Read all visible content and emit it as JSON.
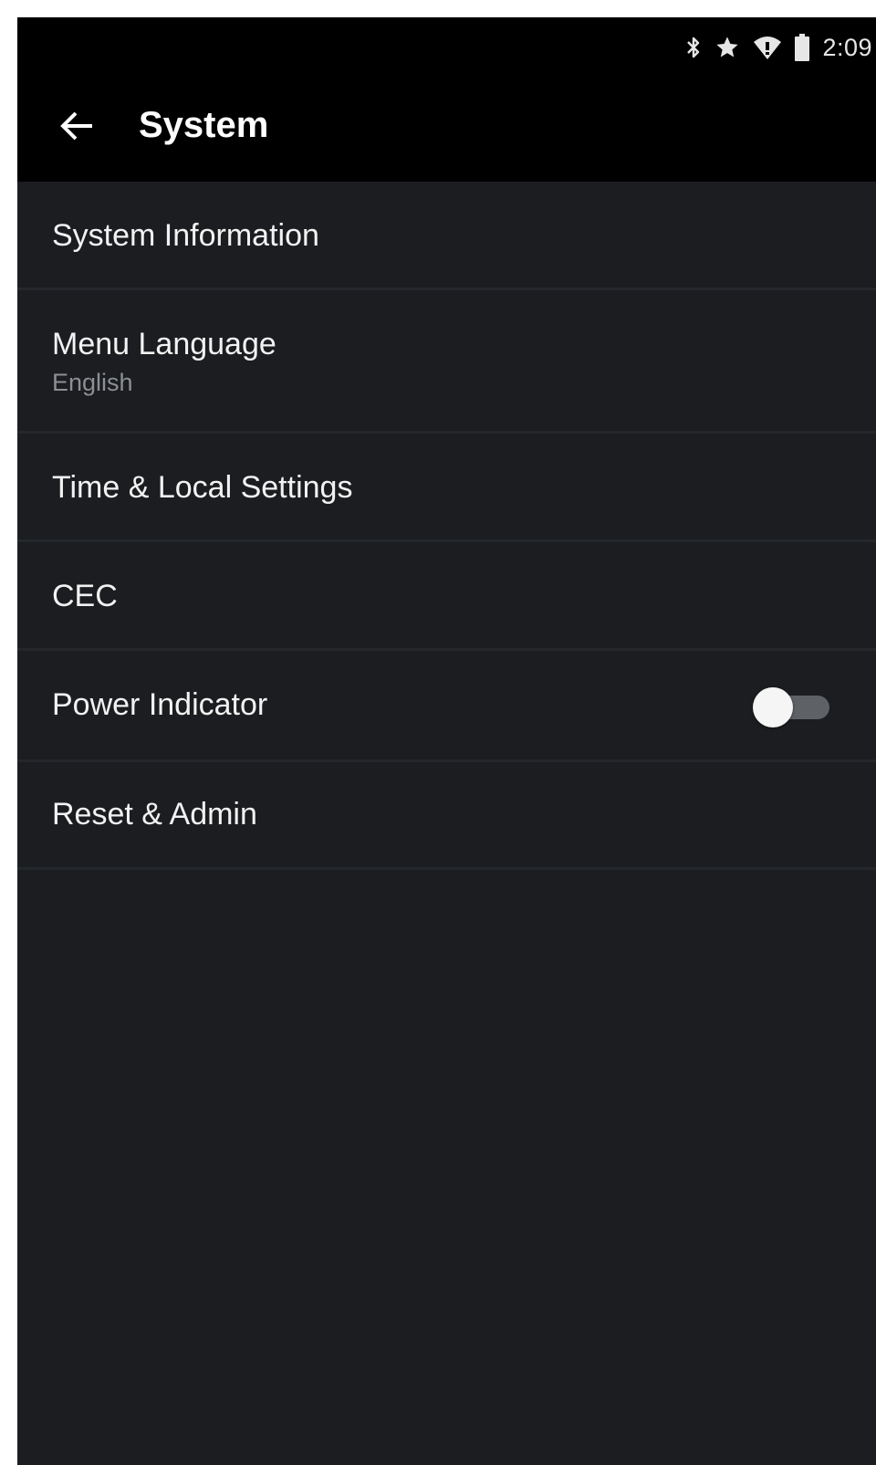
{
  "status_bar": {
    "time": "2:09",
    "icons": [
      "bluetooth-icon",
      "star-icon",
      "wifi-icon",
      "battery-icon"
    ]
  },
  "app_bar": {
    "back_icon": "arrow-back-icon",
    "title": "System"
  },
  "menu": {
    "items": [
      {
        "label": "System Information"
      },
      {
        "label": "Menu Language",
        "sublabel": "English"
      },
      {
        "label": "Time & Local Settings"
      },
      {
        "label": "CEC"
      },
      {
        "label": "Power Indicator",
        "toggle": "off"
      },
      {
        "label": "Reset & Admin"
      }
    ]
  },
  "colors": {
    "background": "#1b1d20",
    "header": "#000000",
    "divider": "#24272b",
    "text_primary": "#f2f2f2",
    "text_secondary": "#8c8f93"
  }
}
